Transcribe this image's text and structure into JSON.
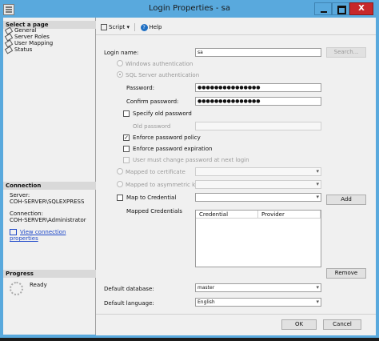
{
  "window": {
    "title": "Login Properties - sa",
    "close_glyph": "X"
  },
  "left": {
    "select_page_header": "Select a page",
    "pages": [
      "General",
      "Server Roles",
      "User Mapping",
      "Status"
    ],
    "connection_header": "Connection",
    "server_label": "Server:",
    "server_value": "COH-SERVER\\SQLEXPRESS",
    "connection_label": "Connection:",
    "connection_value": "COH-SERVER\\Administrator",
    "view_connection_link": "View connection properties",
    "progress_header": "Progress",
    "progress_status": "Ready"
  },
  "toolbar": {
    "script_label": "Script",
    "script_arrow": "▾",
    "help_label": "Help",
    "help_glyph": "?"
  },
  "form": {
    "login_name_label": "Login name:",
    "login_name_value": "sa",
    "search_button": "Search...",
    "windows_auth": "Windows authentication",
    "sql_auth": "SQL Server authentication",
    "password_label": "Password:",
    "password_value": "●●●●●●●●●●●●●●●",
    "confirm_password_label": "Confirm password:",
    "confirm_password_value": "●●●●●●●●●●●●●●●",
    "specify_old_password": "Specify old password",
    "old_password_label": "Old password",
    "enforce_policy": "Enforce password policy",
    "enforce_expiration": "Enforce password expiration",
    "must_change": "User must change password at next login",
    "mapped_to_certificate": "Mapped to certificate",
    "mapped_to_asymmetric_key": "Mapped to asymmetric key",
    "map_to_credential": "Map to Credential",
    "add_button": "Add",
    "mapped_credentials_label": "Mapped Credentials",
    "credential_columns": [
      "Credential",
      "Provider"
    ],
    "remove_button": "Remove",
    "default_database_label": "Default database:",
    "default_database_value": "master",
    "default_language_label": "Default language:",
    "default_language_value": "English",
    "checked_glyph": "✓"
  },
  "footer": {
    "ok_button": "OK",
    "cancel_button": "Cancel"
  },
  "colors": {
    "titlebar": "#59a9dd",
    "close": "#c7282a",
    "link": "#1c47c9"
  }
}
